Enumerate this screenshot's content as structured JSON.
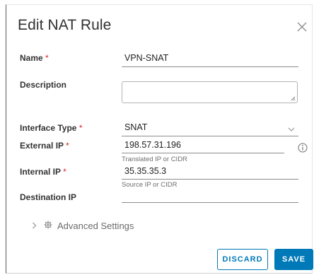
{
  "dialog": {
    "title": "Edit NAT Rule",
    "close_icon": "close-icon"
  },
  "form": {
    "name": {
      "label": "Name",
      "required_mark": "*",
      "value": "VPN-SNAT"
    },
    "description": {
      "label": "Description",
      "value": ""
    },
    "interface_type": {
      "label": "Interface Type",
      "required_mark": "*",
      "value": "SNAT",
      "icon": "chevron-down-icon"
    },
    "external_ip": {
      "label": "External IP",
      "required_mark": "*",
      "value": "198.57.31.196",
      "helper": "Translated IP or CIDR",
      "icon": "info-icon"
    },
    "internal_ip": {
      "label": "Internal IP",
      "required_mark": "*",
      "value": "35.35.35.3",
      "helper": "Source IP or CIDR"
    },
    "destination_ip": {
      "label": "Destination IP",
      "value": ""
    }
  },
  "advanced": {
    "label": "Advanced Settings",
    "icons": [
      "chevron-right-icon",
      "gear-icon"
    ]
  },
  "buttons": {
    "discard": "DISCARD",
    "save": "SAVE"
  },
  "colors": {
    "primary": "#0079b8",
    "required": "#e02020"
  }
}
